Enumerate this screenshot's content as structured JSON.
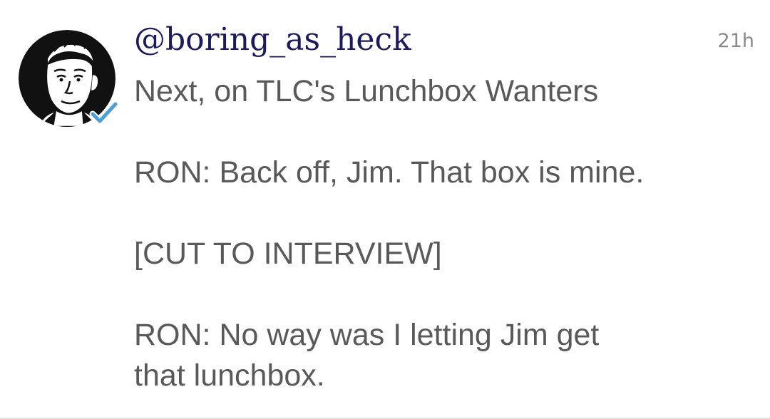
{
  "post": {
    "username": "@boring_as_heck",
    "timestamp": "21h",
    "verified_icon": "verified-check-icon",
    "avatar_icon": "cartoon-face-avatar",
    "lines": [
      "Next, on TLC's Lunchbox Wanters",
      "",
      "RON: Back off, Jim. That box is mine.",
      "",
      "[CUT TO INTERVIEW]",
      "",
      "RON: No way was I letting Jim get",
      "that lunchbox."
    ]
  },
  "colors": {
    "username": "#1c1a5e",
    "body_text": "#595959",
    "timestamp": "#8a8a8a",
    "verified": "#4a9fd8"
  }
}
